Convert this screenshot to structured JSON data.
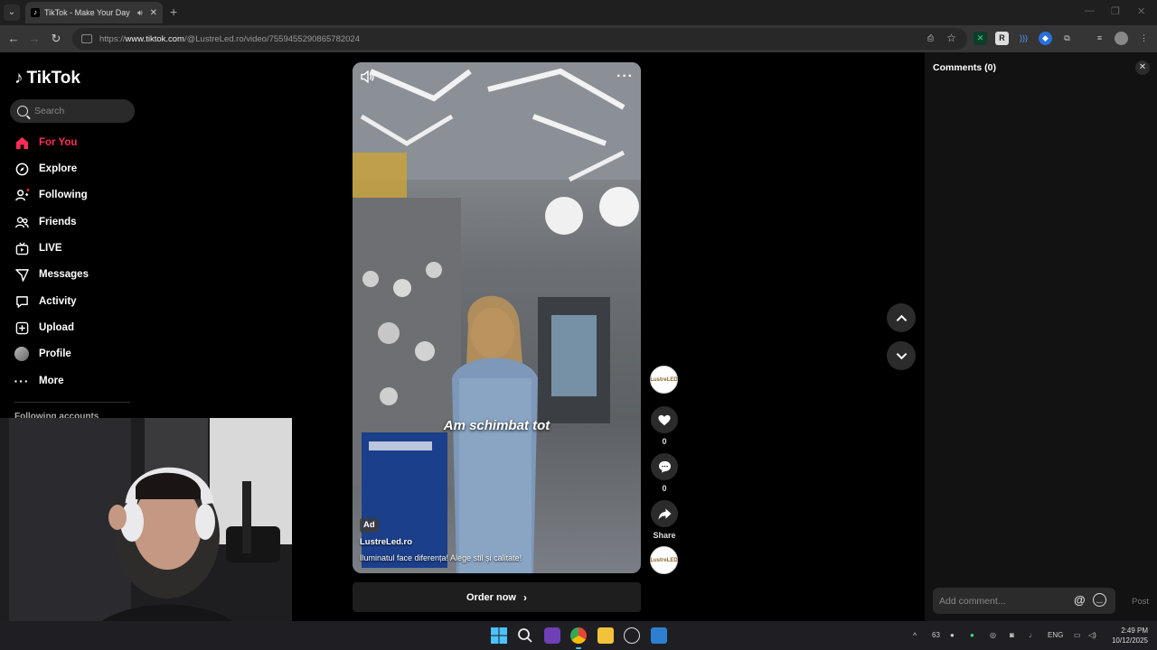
{
  "browser": {
    "tab_title": "TikTok - Make Your Day",
    "url_prefix": "https://",
    "url_host": "www.tiktok.com",
    "url_path": "/@LustreLed.ro/video/7559455290865782024"
  },
  "sidebar": {
    "brand": "TikTok",
    "search_placeholder": "Search",
    "items": [
      {
        "label": "For You",
        "icon": "home-icon"
      },
      {
        "label": "Explore",
        "icon": "compass-icon"
      },
      {
        "label": "Following",
        "icon": "following-icon"
      },
      {
        "label": "Friends",
        "icon": "friends-icon"
      },
      {
        "label": "LIVE",
        "icon": "live-icon"
      },
      {
        "label": "Messages",
        "icon": "messages-icon"
      },
      {
        "label": "Activity",
        "icon": "activity-icon"
      },
      {
        "label": "Upload",
        "icon": "upload-icon"
      },
      {
        "label": "Profile",
        "icon": "profile-avatar"
      },
      {
        "label": "More",
        "icon": "more-icon"
      }
    ],
    "following_accounts": "Following accounts"
  },
  "video": {
    "caption_overlay": "Am schimbat tot",
    "ad_badge": "Ad",
    "author": "LustreLed.ro",
    "description": "Iluminatul face diferența! Alege stil și calitate!",
    "cta": "Order now"
  },
  "actions": {
    "likes": "0",
    "comments": "0",
    "share_label": "Share",
    "brand_avatar_text": "LustreLED"
  },
  "comments_panel": {
    "title": "Comments (0)",
    "placeholder": "Add comment...",
    "post_label": "Post"
  },
  "taskbar": {
    "temp": "63",
    "lang": "ENG",
    "time": "2:49 PM",
    "date": "10/12/2025"
  },
  "colors": {
    "accent": "#fe2c55",
    "background": "#000000",
    "panel": "#121212"
  }
}
